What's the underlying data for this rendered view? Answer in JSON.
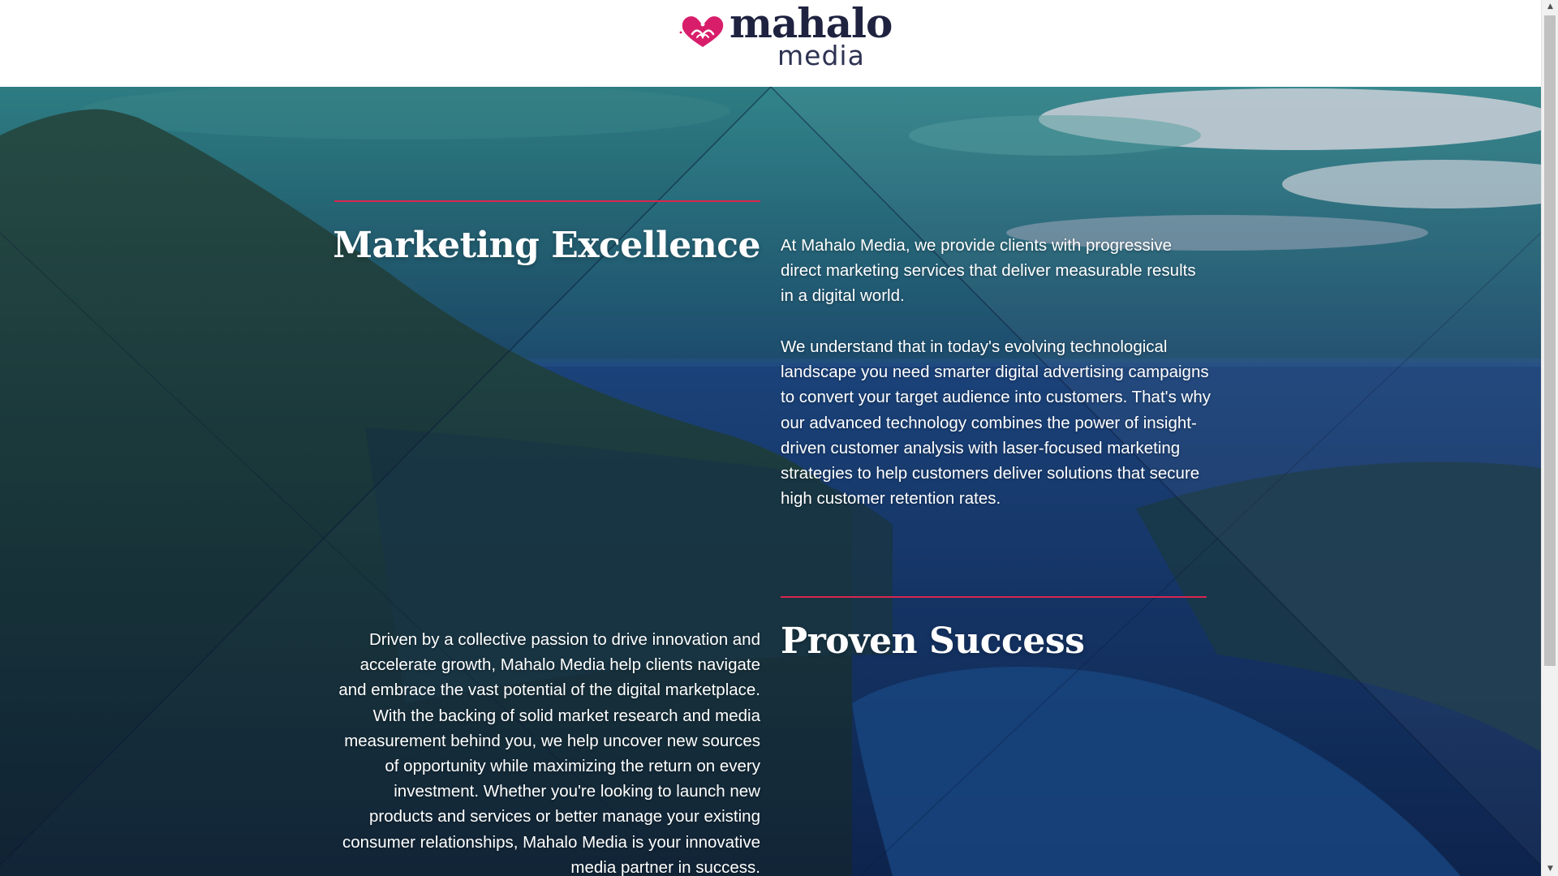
{
  "header": {
    "logo": {
      "wordmark_top": "mahalo",
      "wordmark_bottom": "media",
      "icon": "hibiscus-heart-icon",
      "brand_color": "#d81e6b",
      "text_color": "#1f2340"
    }
  },
  "colors": {
    "accent_rule": "#d8274f",
    "hero_text": "#ffffff"
  },
  "sections": {
    "marketing": {
      "heading": "Marketing Excellence",
      "paragraph_1": "At Mahalo Media, we provide clients with progressive direct marketing services that deliver measurable results in a digital world.",
      "paragraph_2": "We understand that in today's evolving technological landscape you need smarter digital advertising campaigns to convert your target audience into customers. That's why our advanced technology combines the power of insight-driven customer analysis with laser-focused marketing strategies to help customers deliver solutions that secure high customer retention rates."
    },
    "success": {
      "heading": "Proven Success",
      "paragraph": "Driven by a collective passion to drive innovation and accelerate growth, Mahalo Media help clients navigate and embrace the vast potential of the digital marketplace. With the backing of solid market research and media measurement behind you, we help uncover new sources of opportunity while maximizing the return on every investment. Whether you're looking to launch new products and services or better manage your existing consumer relationships, Mahalo Media is your innovative media partner in success."
    }
  },
  "scrollbar": {
    "up_icon": "▲",
    "down_icon": "▼"
  }
}
